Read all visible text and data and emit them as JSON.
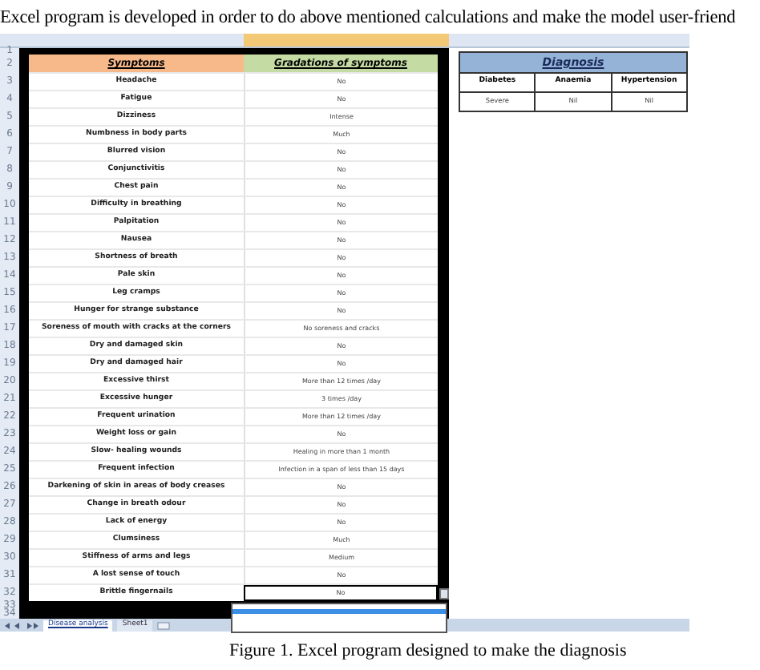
{
  "intro_text": "Excel program is developed in order to do above mentioned calculations and make the model user-friend",
  "sheet": {
    "row_numbers": [
      "1",
      "2",
      "3",
      "4",
      "5",
      "6",
      "7",
      "8",
      "9",
      "10",
      "11",
      "12",
      "13",
      "14",
      "15",
      "16",
      "17",
      "18",
      "19",
      "20",
      "21",
      "22",
      "23",
      "24",
      "25",
      "26",
      "27",
      "28",
      "29",
      "30",
      "31",
      "32",
      "33",
      "34"
    ],
    "symptoms_table": {
      "columns": [
        "Symptoms",
        "Gradations of symptoms"
      ],
      "rows": [
        {
          "symptom": "Headache",
          "gradation": "No"
        },
        {
          "symptom": "Fatigue",
          "gradation": "No"
        },
        {
          "symptom": "Dizziness",
          "gradation": "Intense"
        },
        {
          "symptom": "Numbness in body parts",
          "gradation": "Much"
        },
        {
          "symptom": "Blurred vision",
          "gradation": "No"
        },
        {
          "symptom": "Conjunctivitis",
          "gradation": "No"
        },
        {
          "symptom": "Chest pain",
          "gradation": "No"
        },
        {
          "symptom": "Difficulty in breathing",
          "gradation": "No"
        },
        {
          "symptom": "Palpitation",
          "gradation": "No"
        },
        {
          "symptom": "Nausea",
          "gradation": "No"
        },
        {
          "symptom": "Shortness of breath",
          "gradation": "No"
        },
        {
          "symptom": "Pale skin",
          "gradation": "No"
        },
        {
          "symptom": "Leg cramps",
          "gradation": "No"
        },
        {
          "symptom": "Hunger for strange substance",
          "gradation": "No"
        },
        {
          "symptom": "Soreness of mouth with cracks at the corners",
          "gradation": "No soreness and cracks"
        },
        {
          "symptom": "Dry and damaged skin",
          "gradation": "No"
        },
        {
          "symptom": "Dry and damaged hair",
          "gradation": "No"
        },
        {
          "symptom": "Excessive thirst",
          "gradation": "More than 12 times /day"
        },
        {
          "symptom": "Excessive hunger",
          "gradation": "3 times /day"
        },
        {
          "symptom": "Frequent urination",
          "gradation": "More than 12 times /day"
        },
        {
          "symptom": "Weight loss or gain",
          "gradation": "No"
        },
        {
          "symptom": "Slow- healing wounds",
          "gradation": "Healing in more than 1 month"
        },
        {
          "symptom": "Frequent infection",
          "gradation": "Infection in a span of less than 15 days"
        },
        {
          "symptom": "Darkening of skin in areas of body creases",
          "gradation": "No"
        },
        {
          "symptom": "Change in breath odour",
          "gradation": "No"
        },
        {
          "symptom": "Lack of energy",
          "gradation": "No"
        },
        {
          "symptom": "Clumsiness",
          "gradation": "Much"
        },
        {
          "symptom": "Stiffness of arms and legs",
          "gradation": "Medium"
        },
        {
          "symptom": "A lost sense of touch",
          "gradation": "No"
        },
        {
          "symptom": "Brittle fingernails",
          "gradation": "No",
          "selected": true
        }
      ]
    },
    "dropdown": {
      "open": true
    },
    "diagnosis_table": {
      "title": "Diagnosis",
      "columns": [
        "Diabetes",
        "Anaemia",
        "Hypertension"
      ],
      "values": [
        "Severe",
        "Nil",
        "Nil"
      ]
    },
    "sheet_tabs": [
      {
        "label": "Disease analysis",
        "selected": true
      },
      {
        "label": "Sheet1",
        "selected": false
      }
    ]
  },
  "caption": "Figure 1. Excel program designed to make the diagnosis"
}
